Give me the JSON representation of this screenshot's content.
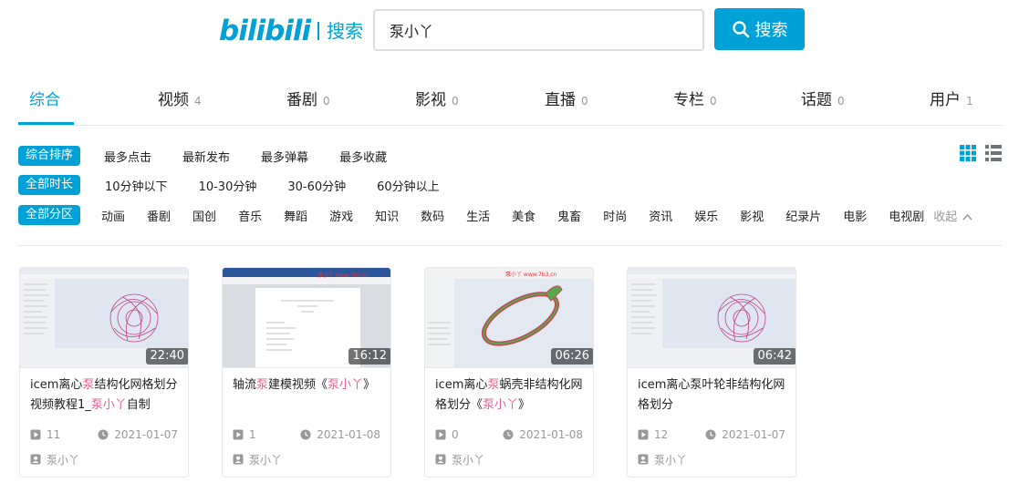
{
  "header": {
    "logo_text": "bilibili",
    "logo_sub": "搜索",
    "search_value": "泵小丫",
    "search_button": "搜索"
  },
  "tabs": [
    {
      "label": "综合",
      "count": ""
    },
    {
      "label": "视频",
      "count": "4"
    },
    {
      "label": "番剧",
      "count": "0"
    },
    {
      "label": "影视",
      "count": "0"
    },
    {
      "label": "直播",
      "count": "0"
    },
    {
      "label": "专栏",
      "count": "0"
    },
    {
      "label": "话题",
      "count": "0"
    },
    {
      "label": "用户",
      "count": "1"
    }
  ],
  "filters": {
    "sort": {
      "selected": "综合排序",
      "options": [
        "最多点击",
        "最新发布",
        "最多弹幕",
        "最多收藏"
      ]
    },
    "duration": {
      "selected": "全部时长",
      "options": [
        "10分钟以下",
        "10-30分钟",
        "30-60分钟",
        "60分钟以上"
      ]
    },
    "zone": {
      "selected": "全部分区",
      "options": [
        "动画",
        "番剧",
        "国创",
        "音乐",
        "舞蹈",
        "游戏",
        "知识",
        "数码",
        "生活",
        "美食",
        "鬼畜",
        "时尚",
        "资讯",
        "娱乐",
        "影视",
        "纪录片",
        "电影",
        "电视剧"
      ],
      "collapse": "收起"
    }
  },
  "colors": {
    "accent": "#00a1d6",
    "keyword": "#e8618c"
  },
  "videos": [
    {
      "duration": "22:40",
      "title_pre": "icem离心",
      "title_kw1": "泵",
      "title_mid": "结构化网格划分视频教程1_",
      "title_kw2": "泵小丫",
      "title_post": "自制",
      "views": "11",
      "date": "2021-01-07",
      "author": "泵小丫",
      "thumb_caption": ""
    },
    {
      "duration": "16:12",
      "title_pre": "轴流",
      "title_kw1": "泵",
      "title_mid": "建模视频《",
      "title_kw2": "泵小丫",
      "title_post": "》",
      "views": "1",
      "date": "2021-01-08",
      "author": "泵小丫",
      "thumb_caption": "泵小丫 www.7b3.cn"
    },
    {
      "duration": "06:26",
      "title_pre": "icem离心",
      "title_kw1": "泵",
      "title_mid": "蜗壳非结构化网格划分《",
      "title_kw2": "泵小丫",
      "title_post": "》",
      "views": "0",
      "date": "2021-01-08",
      "author": "泵小丫",
      "thumb_caption": "泵小丫 www.7b3.cn"
    },
    {
      "duration": "06:42",
      "title_pre": "icem离心泵叶轮非结构化网格划分",
      "title_kw1": "",
      "title_mid": "",
      "title_kw2": "",
      "title_post": "",
      "views": "12",
      "date": "2021-01-07",
      "author": "泵小丫",
      "thumb_caption": ""
    }
  ]
}
